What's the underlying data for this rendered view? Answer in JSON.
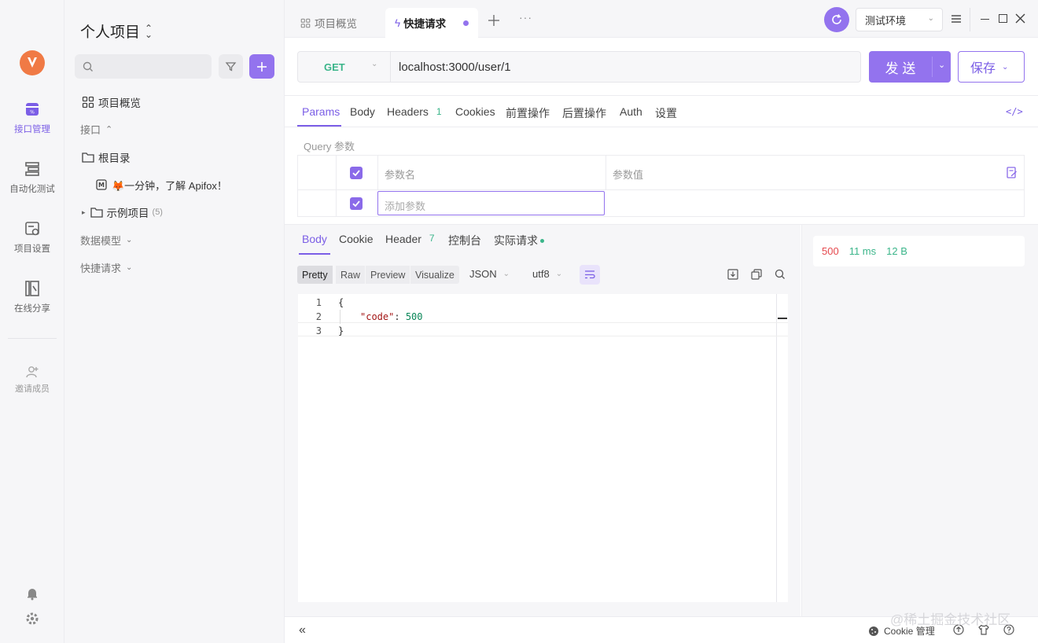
{
  "rail": {
    "items": [
      {
        "label": "接口管理",
        "icon": "api-management-icon",
        "active": true
      },
      {
        "label": "自动化测试",
        "icon": "automation-test-icon"
      },
      {
        "label": "项目设置",
        "icon": "project-settings-icon"
      },
      {
        "label": "在线分享",
        "icon": "online-share-icon"
      }
    ],
    "invite_label": "邀请成员"
  },
  "panel": {
    "project_title": "个人项目",
    "overview_label": "项目概览",
    "api_section": "接口",
    "root_dir": "根目录",
    "doc_item": "🦊一分钟，了解 Apifox！",
    "example_folder": "示例项目",
    "example_count": "(5)",
    "data_model": "数据模型",
    "quick_request": "快捷请求"
  },
  "tabs": {
    "overview": "项目概览",
    "quick": "快捷请求"
  },
  "env": {
    "selected": "测试环境"
  },
  "request": {
    "method": "GET",
    "url": "localhost:3000/user/1",
    "send_label": "发 送",
    "save_label": "保存"
  },
  "req_tabs": [
    {
      "label": "Params",
      "active": true
    },
    {
      "label": "Body"
    },
    {
      "label": "Headers",
      "badge": "1"
    },
    {
      "label": "Cookies"
    },
    {
      "label": "前置操作"
    },
    {
      "label": "后置操作"
    },
    {
      "label": "Auth"
    },
    {
      "label": "设置"
    }
  ],
  "params": {
    "section_label": "Query 参数",
    "col_name": "参数名",
    "col_value": "参数值",
    "add_placeholder": "添加参数"
  },
  "resp_tabs": [
    {
      "label": "Body",
      "active": true
    },
    {
      "label": "Cookie"
    },
    {
      "label": "Header",
      "badge": "7"
    },
    {
      "label": "控制台"
    },
    {
      "label": "实际请求"
    }
  ],
  "view_modes": [
    "Pretty",
    "Raw",
    "Preview",
    "Visualize"
  ],
  "format": "JSON",
  "encoding": "utf8",
  "code_lines": [
    {
      "num": "1",
      "text": "{"
    },
    {
      "num": "2",
      "key": "\"code\"",
      "value": "500"
    },
    {
      "num": "3",
      "text": "}"
    }
  ],
  "status": {
    "code": "500",
    "time": "11 ms",
    "size": "12 B"
  },
  "footer": {
    "cookie_label": "Cookie 管理"
  },
  "watermark": "@稀土掘金技术社区",
  "colors": {
    "accent": "#9373ee",
    "status_error": "#e5484d",
    "status_ok": "#3bb58a"
  }
}
